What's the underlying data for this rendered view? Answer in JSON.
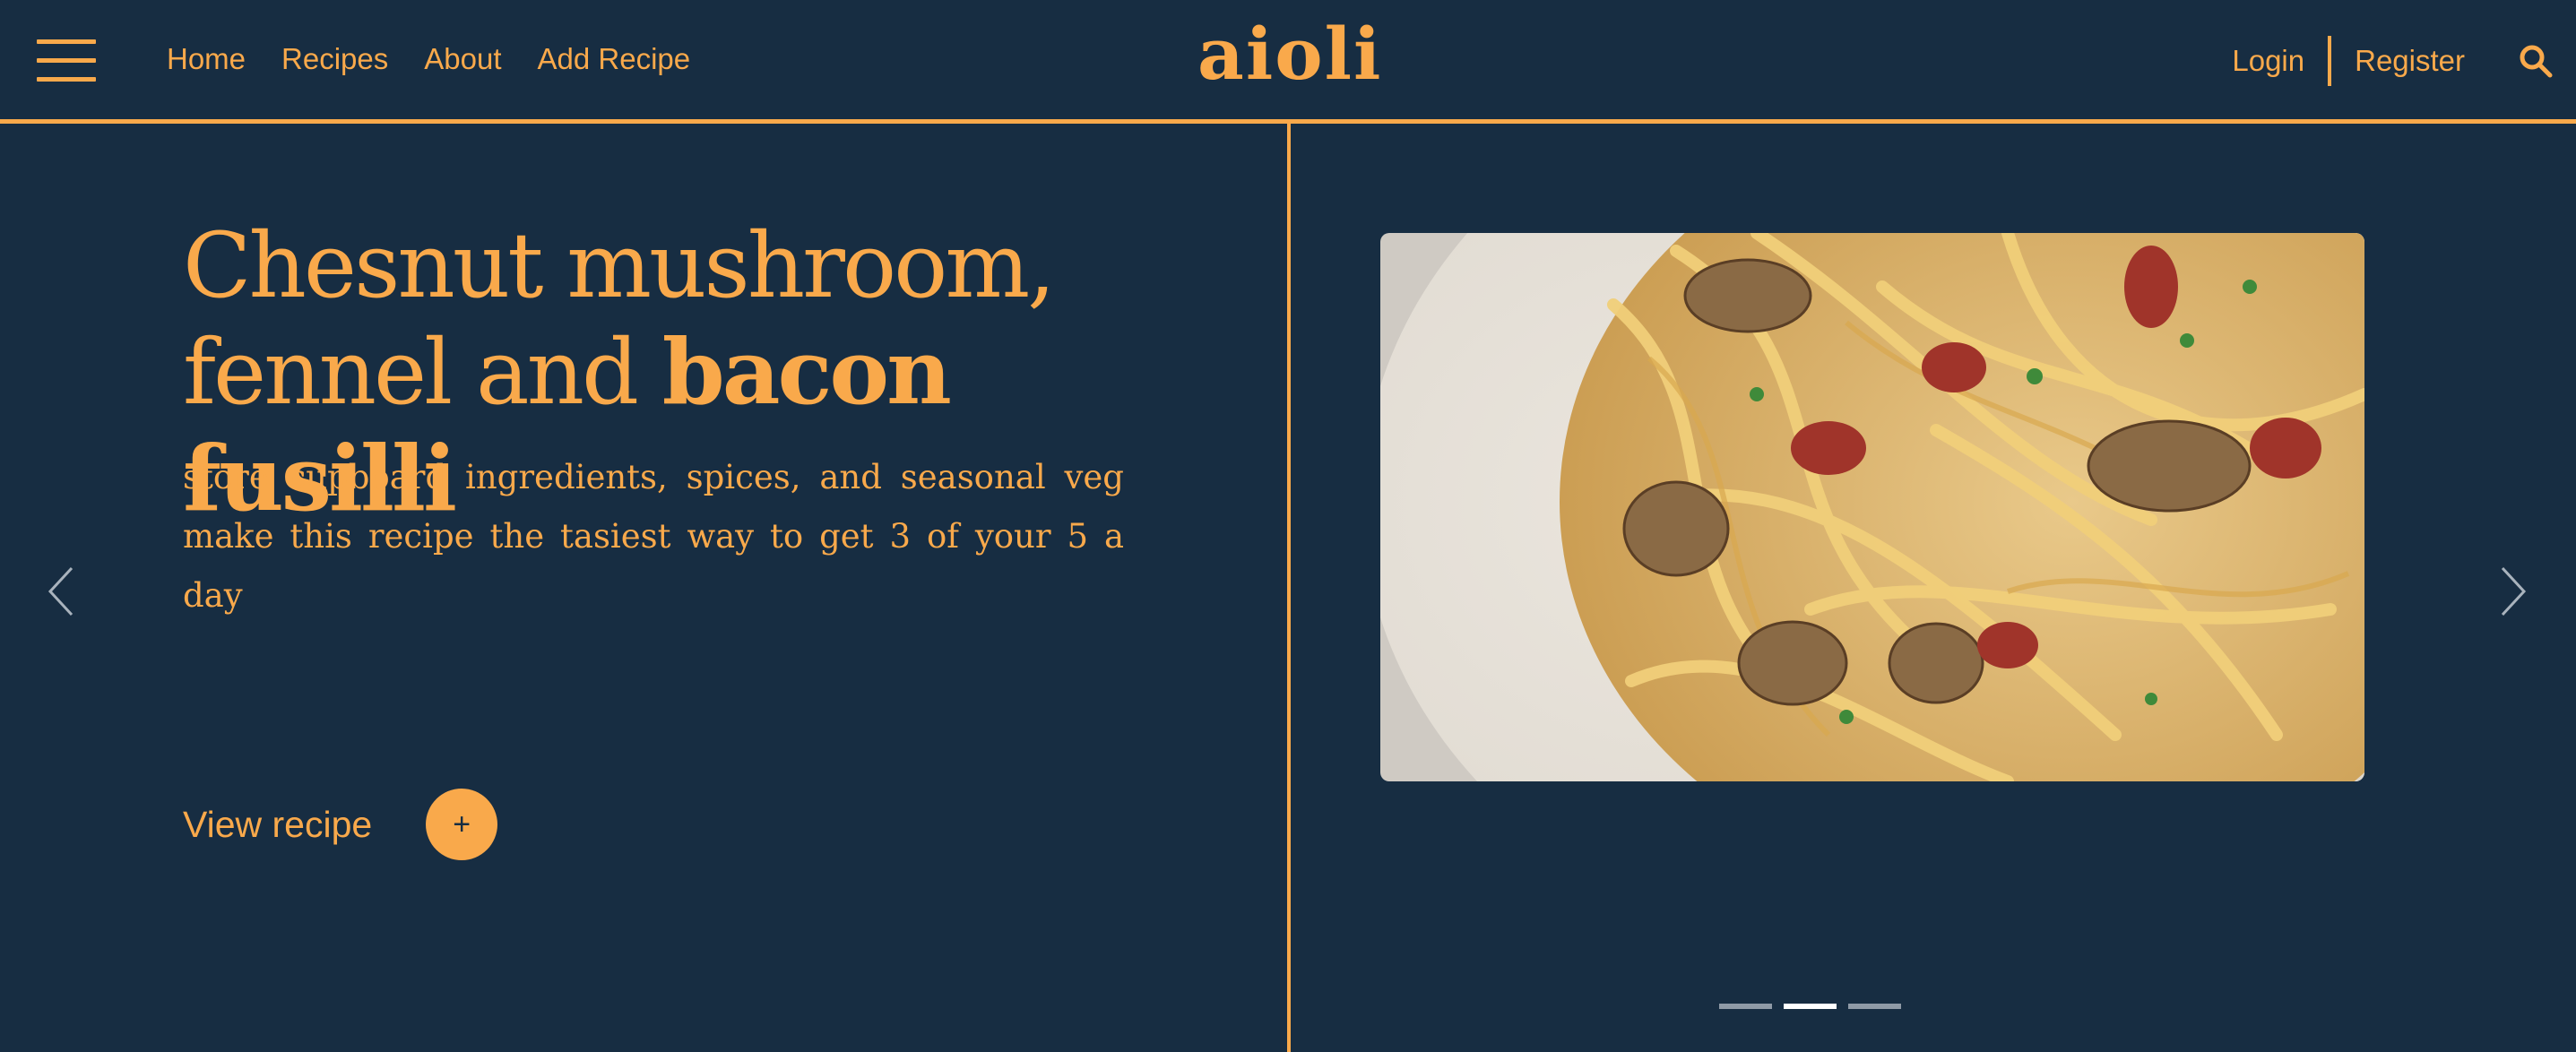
{
  "header": {
    "nav": {
      "home": "Home",
      "recipes": "Recipes",
      "about": "About",
      "add_recipe": "Add Recipe"
    },
    "logo": "aioli",
    "auth": {
      "login": "Login",
      "register": "Register"
    },
    "icons": {
      "menu": "hamburger-menu-icon",
      "search": "search-icon"
    }
  },
  "hero": {
    "title_part1": "Chesnut mushroom, fennel and ",
    "title_part2": "bacon fusilli",
    "description": "store cupboard ingredients, spices, and seasonal veg make this recipe the tasiest way to get 3 of your 5 a day",
    "cta_label": "View recipe",
    "cta_icon": "+",
    "image": "creamy mushroom bacon pasta photo"
  },
  "carousel": {
    "slide_count": 3,
    "active_slide": 2,
    "prev_icon": "chevron-left-icon",
    "next_icon": "chevron-right-icon"
  },
  "colors": {
    "background": "#172d42",
    "accent": "#f9a94b",
    "dot_active": "#ffffff",
    "dot_inactive": "#8f9aa6"
  }
}
